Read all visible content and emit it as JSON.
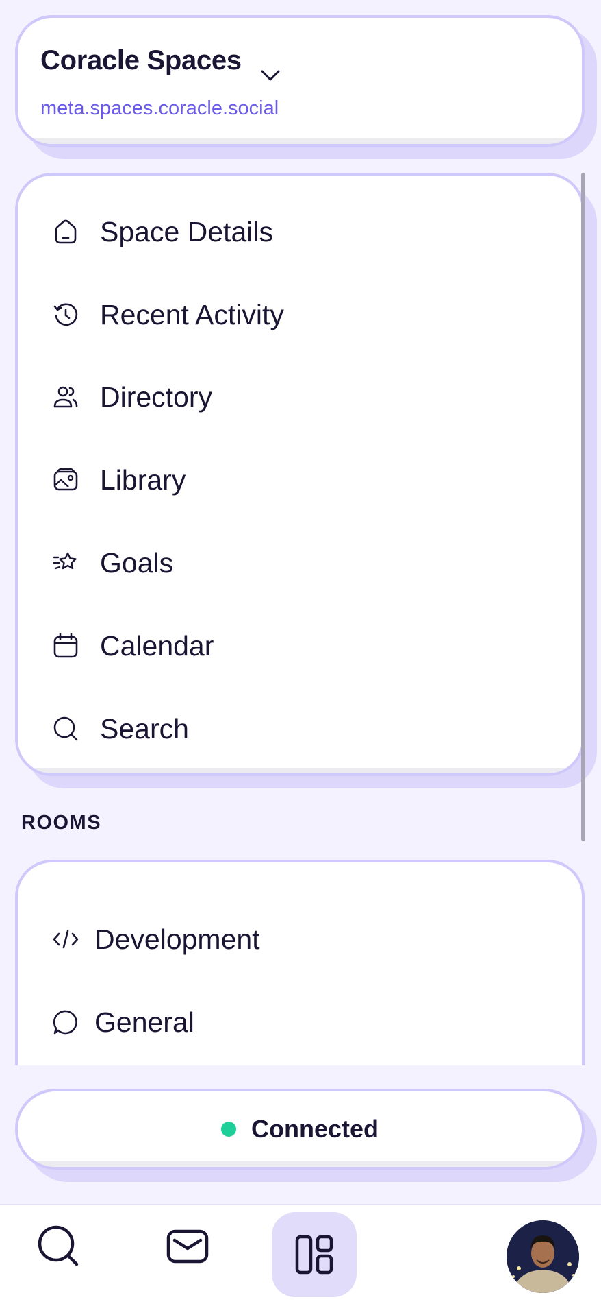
{
  "space": {
    "name": "Coracle Spaces",
    "url": "meta.spaces.coracle.social"
  },
  "nav": {
    "items": [
      {
        "label": "Space Details",
        "icon": "house-icon"
      },
      {
        "label": "Recent Activity",
        "icon": "history-icon"
      },
      {
        "label": "Directory",
        "icon": "users-icon"
      },
      {
        "label": "Library",
        "icon": "gallery-icon"
      },
      {
        "label": "Goals",
        "icon": "star-fall-icon"
      },
      {
        "label": "Calendar",
        "icon": "calendar-icon"
      },
      {
        "label": "Search",
        "icon": "search-icon"
      }
    ]
  },
  "rooms": {
    "heading": "ROOMS",
    "items": [
      {
        "label": "Development",
        "icon": "code-icon"
      },
      {
        "label": "General",
        "icon": "chat-bubble-icon"
      }
    ]
  },
  "status": {
    "label": "Connected",
    "color": "#1fcf99"
  },
  "bottom_bar": {
    "items": [
      "search-icon",
      "mail-icon",
      "spaces-layout-icon",
      "avatar"
    ]
  },
  "colors": {
    "accent": "#6b5ce7",
    "card_border": "#cfc8fb",
    "background": "#f4f2fe",
    "active_tab": "#e0dcf9"
  }
}
